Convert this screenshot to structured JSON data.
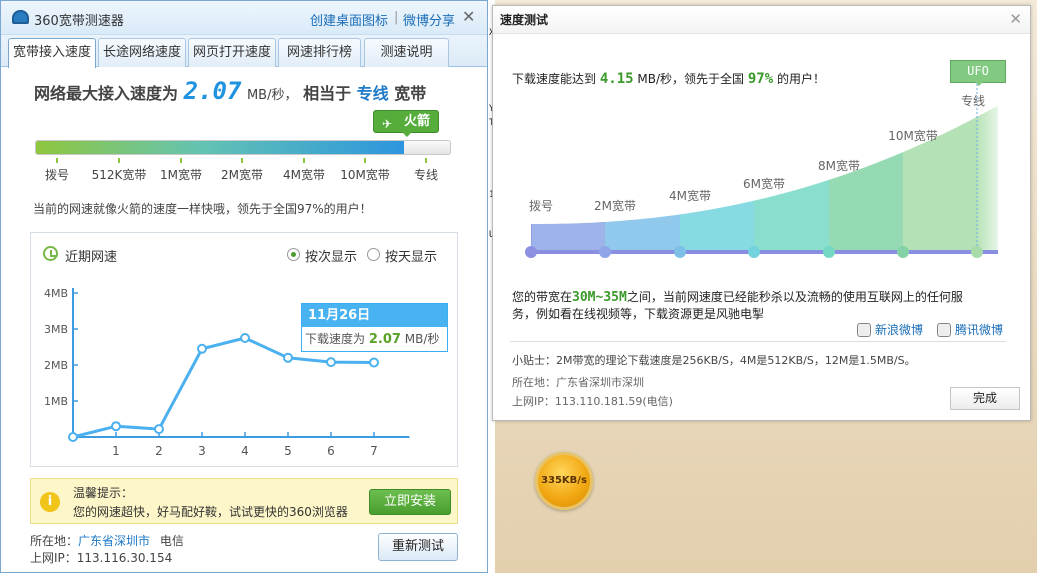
{
  "left": {
    "app_title": "360宽带测速器",
    "actions": {
      "create_icon": "创建桌面图标",
      "separator": "|",
      "weibo_share": "微博分享"
    },
    "close": "✕",
    "tabs": [
      "宽带接入速度",
      "长途网络速度",
      "网页打开速度",
      "网速排行榜",
      "测速说明"
    ],
    "headline": {
      "prefix": "网络最大接入速度为",
      "speed": "2.07",
      "unit": "MB/秒，",
      "middle": "相当于",
      "type": "专线",
      "suffix": "宽带"
    },
    "badge": "火箭",
    "progress_fraction": 0.89,
    "scale_labels": [
      "拨号",
      "512K宽带",
      "1M宽带",
      "2M宽带",
      "4M宽带",
      "10M宽带",
      "专线"
    ],
    "comparison_text": "当前的网速就像火箭的速度一样快哦，领先于全国97%的用户！",
    "recent": {
      "title": "近期网速",
      "radio_by_count": "按次显示",
      "radio_by_day": "按天显示",
      "tooltip_date": "11月26日",
      "tooltip_label": "下载速度为",
      "tooltip_value": "2.07",
      "tooltip_unit": "MB/秒"
    },
    "notice": {
      "title": "温馨提示：",
      "body": "您的网速超快，好马配好鞍，试试更快的360浏览器",
      "button": "立即安装"
    },
    "location_label": "所在地：",
    "location_value": "广东省深圳市",
    "isp": "电信",
    "ip_label": "上网IP：",
    "ip_value": "113.116.30.154",
    "retest": "重新测试"
  },
  "chart_data": {
    "type": "line",
    "x": [
      0,
      1,
      2,
      3,
      4,
      5,
      6,
      7
    ],
    "x_tick_labels": [
      "1",
      "2",
      "3",
      "4",
      "5",
      "6",
      "7"
    ],
    "y_tick_labels": [
      "1MB",
      "2MB",
      "3MB",
      "4MB"
    ],
    "series": [
      {
        "values": [
          0,
          0.3,
          0.22,
          2.45,
          2.75,
          2.2,
          2.08,
          2.07
        ]
      }
    ],
    "ylim": [
      0,
      4
    ],
    "xlim": [
      0,
      7.8
    ],
    "grid": false
  },
  "right": {
    "title": "速度测试",
    "close": "✕",
    "download_pre": "下载速度能达到",
    "download_value": "4.15",
    "download_unit": "MB/秒，领先于全国",
    "download_percent": "97%",
    "download_post": "的用户！",
    "ufo": "UFO",
    "stages": [
      "拨号",
      "2M宽带",
      "4M宽带",
      "6M宽带",
      "8M宽带",
      "10M宽带",
      "专线"
    ],
    "stage_colors": [
      "#8d8fe0",
      "#8ea6e8",
      "#7dbfe7",
      "#72d3dc",
      "#75d8c5",
      "#83d3a6",
      "#a7dca8"
    ],
    "bandwidth_pre": "您的带宽在",
    "bandwidth_value": "30M~35M",
    "bandwidth_post1": "之间，当前网速度已经能秒杀以及流畅的使用互联网上的任何服",
    "bandwidth_post2": "务，例如看在线视频等，下载资源更是风驰电掣",
    "share_sina": "新浪微博",
    "share_tencent": "腾讯微博",
    "tip": "小贴士：2M带宽的理论下载速度是256KB/S，4M是512KB/S，12M是1.5MB/S。",
    "location": "所在地：广东省深圳市深圳",
    "ip": "上网IP：113.110.181.59(电信)",
    "done": "完成"
  },
  "floating_speed": "335KB/s",
  "background_fragments": [
    "X",
    "Y",
    "T",
    "1",
    "U"
  ]
}
